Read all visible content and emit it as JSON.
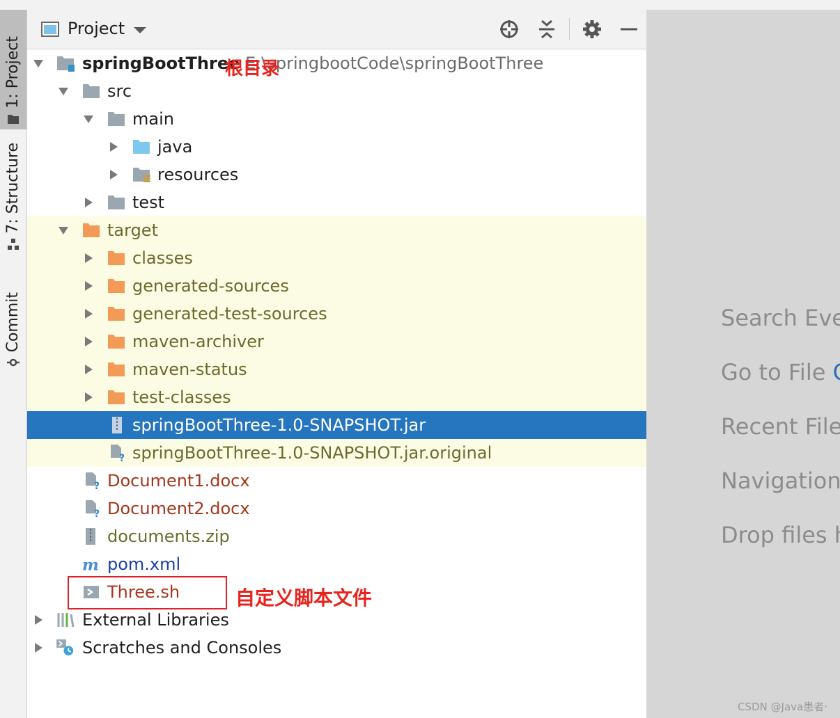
{
  "left_toolbar": {
    "project_tab": "1: Project",
    "structure_tab": "7: Structure",
    "commit_tab": "Commit"
  },
  "panel": {
    "title": "Project",
    "buttons": [
      "locate",
      "collapse-all",
      "settings",
      "hide"
    ]
  },
  "tree": {
    "root_name": "springBootThree",
    "root_path": "E:\\springbootCode\\springBootThree",
    "src": "src",
    "main": "main",
    "java": "java",
    "resources": "resources",
    "test": "test",
    "target": "target",
    "classes": "classes",
    "generated_sources": "generated-sources",
    "generated_test_sources": "generated-test-sources",
    "maven_archiver": "maven-archiver",
    "maven_status": "maven-status",
    "test_classes": "test-classes",
    "jar": "springBootThree-1.0-SNAPSHOT.jar",
    "jar_original": "springBootThree-1.0-SNAPSHOT.jar.original",
    "doc1": "Document1.docx",
    "doc2": "Document2.docx",
    "zip": "documents.zip",
    "pom": "pom.xml",
    "sh": "Three.sh",
    "external_libraries": "External Libraries",
    "scratches": "Scratches and Consoles"
  },
  "annotations": {
    "root_note": "根目录",
    "script_note": "自定义脚本文件"
  },
  "editor_hints": {
    "search": "Search Everywhere",
    "goto": "Go to File",
    "goto_shortcut": "Ctrl+Shift+N",
    "recent": "Recent Files",
    "nav": "Navigation Bar",
    "drop": "Drop files here to open"
  },
  "watermark": "CSDN @Java患者·"
}
